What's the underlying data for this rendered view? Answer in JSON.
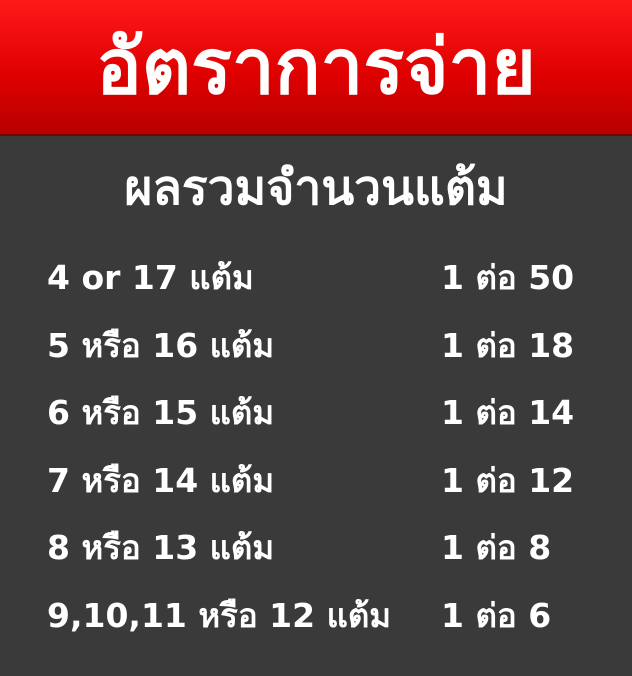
{
  "header": {
    "title": "อัตราการจ่าย"
  },
  "subtitle": "ผลรวมจำนวนแต้ม",
  "rows": [
    {
      "label": "4 or 17 แต้ม",
      "odds": "1 ต่อ 50"
    },
    {
      "label": "5 หรือ 16 แต้ม",
      "odds": "1 ต่อ 18"
    },
    {
      "label": "6 หรือ 15 แต้ม",
      "odds": "1 ต่อ 14"
    },
    {
      "label": "7 หรือ 14 แต้ม",
      "odds": "1 ต่อ 12"
    },
    {
      "label": "8 หรือ 13 แต้ม",
      "odds": "1 ต่อ 8"
    },
    {
      "label": "9,10,11 หรือ 12 แต้ม",
      "odds": "1 ต่อ 6"
    }
  ],
  "colors": {
    "banner": "#e00000",
    "background": "#3a3a3a",
    "text": "#ffffff"
  }
}
